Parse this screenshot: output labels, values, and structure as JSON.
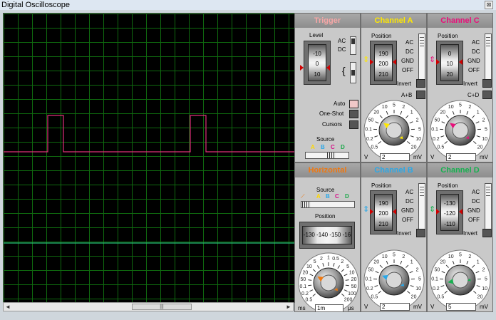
{
  "window": {
    "title": "Digital Oscilloscope",
    "close_glyph": "⊠"
  },
  "scrollbar": {
    "left": "◄",
    "right": "►",
    "grip": "|||"
  },
  "trigger": {
    "title": "Trigger",
    "title_color": "#f6a6a6",
    "level_label": "Level",
    "level_ticks": [
      "-10",
      "0",
      "10"
    ],
    "coupling": [
      "AC",
      "DC"
    ],
    "buttons": [
      "Auto",
      "One-Shot",
      "Cursors"
    ],
    "source_label": "Source",
    "sources": [
      {
        "name": "A",
        "color": "#ffd800"
      },
      {
        "name": "B",
        "color": "#2ba8e8"
      },
      {
        "name": "C",
        "color": "#d6108a"
      },
      {
        "name": "D",
        "color": "#18a848"
      }
    ]
  },
  "horizontal": {
    "title": "Horizontal",
    "title_color": "#f07810",
    "source_label": "Source",
    "source_ramp": "⟋",
    "sources": [
      "A",
      "B",
      "C",
      "D"
    ],
    "position_label": "Position",
    "position_ticks": [
      "-130",
      "-140",
      "-150",
      "-16"
    ],
    "knob_labels": [
      "0.5",
      "0.2",
      "0.1",
      "50",
      "20",
      "10",
      "5",
      "2",
      "1",
      "0.5",
      "2",
      "5",
      "10",
      "20",
      "50",
      "100",
      "200"
    ],
    "units": [
      "ms",
      "μs"
    ],
    "value": "1m"
  },
  "channels": [
    {
      "id": "A",
      "title": "Channel A",
      "color": "#ffe800",
      "position_label": "Position",
      "ticks": [
        "190",
        "200",
        "210"
      ],
      "coupling": [
        "AC",
        "DC",
        "GND",
        "OFF"
      ],
      "invert": "Invert",
      "combine": "A+B",
      "knob_labels": [
        "0.5",
        "0.2",
        "0.1",
        "50",
        "20",
        "10",
        "5",
        "2",
        "1",
        "2",
        "5",
        "10",
        "20"
      ],
      "units": [
        "V",
        "mV"
      ],
      "value": "2"
    },
    {
      "id": "C",
      "title": "Channel C",
      "color": "#e8107a",
      "position_label": "Position",
      "ticks": [
        "0",
        "10",
        "20"
      ],
      "coupling": [
        "AC",
        "DC",
        "GND",
        "OFF"
      ],
      "invert": "Invert",
      "combine": "C+D",
      "knob_labels": [
        "0.5",
        "0.2",
        "0.1",
        "50",
        "20",
        "10",
        "5",
        "2",
        "1",
        "2",
        "5",
        "10",
        "20"
      ],
      "units": [
        "V",
        "mV"
      ],
      "value": "2"
    },
    {
      "id": "B",
      "title": "Channel B",
      "color": "#2aa8e8",
      "position_label": "Position",
      "ticks": [
        "190",
        "200",
        "210"
      ],
      "coupling": [
        "AC",
        "DC",
        "GND",
        "OFF"
      ],
      "invert": "Invert",
      "combine": "",
      "knob_labels": [
        "0.5",
        "0.2",
        "0.1",
        "50",
        "20",
        "10",
        "5",
        "2",
        "1",
        "2",
        "5",
        "10",
        "20"
      ],
      "units": [
        "V",
        "mV"
      ],
      "value": "2"
    },
    {
      "id": "D",
      "title": "Channel D",
      "color": "#18b050",
      "position_label": "Position",
      "ticks": [
        "-130",
        "-120",
        "-110"
      ],
      "coupling": [
        "AC",
        "DC",
        "GND",
        "OFF"
      ],
      "invert": "Invert",
      "combine": "",
      "knob_labels": [
        "0.5",
        "0.2",
        "0.1",
        "50",
        "20",
        "10",
        "5",
        "2",
        "1",
        "2",
        "5",
        "10",
        "20"
      ],
      "units": [
        "V",
        "mV"
      ],
      "value": "5"
    }
  ],
  "display": {
    "grid_color": "#0f6a0f",
    "trace_c_color": "#e0307a",
    "trace_d_color": "#27c07a",
    "trace_c_levels": [
      "low",
      "high",
      "low",
      "high",
      "low"
    ],
    "trace_d_level": "flat"
  }
}
